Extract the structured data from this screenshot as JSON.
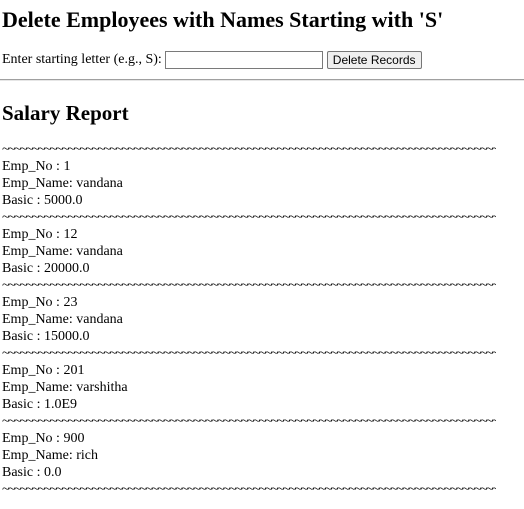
{
  "page": {
    "heading": "Delete Employees with Names Starting with 'S'",
    "form": {
      "label": "Enter starting letter (e.g., S):",
      "input_value": "",
      "button_label": "Delete Records"
    },
    "report_title": "Salary Report",
    "separator": "~~~~~~~~~~~~~~~~~~~~~~~~~~~~~~~~~~~~~~~~~~~~~~~~~~~~~~~~~~~~~~~~~~~~~~~~~~~~~~~~~~~~~~~~~~~~~~~~~~~~~~~",
    "records": [
      {
        "emp_no": "Emp_No : 1",
        "emp_name": "Emp_Name: vandana",
        "basic": "Basic : 5000.0"
      },
      {
        "emp_no": "Emp_No : 12",
        "emp_name": "Emp_Name: vandana",
        "basic": "Basic : 20000.0"
      },
      {
        "emp_no": "Emp_No : 23",
        "emp_name": "Emp_Name: vandana",
        "basic": "Basic : 15000.0"
      },
      {
        "emp_no": "Emp_No : 201",
        "emp_name": "Emp_Name: varshitha",
        "basic": "Basic : 1.0E9"
      },
      {
        "emp_no": "Emp_No : 900",
        "emp_name": "Emp_Name: rich",
        "basic": "Basic : 0.0"
      }
    ]
  }
}
